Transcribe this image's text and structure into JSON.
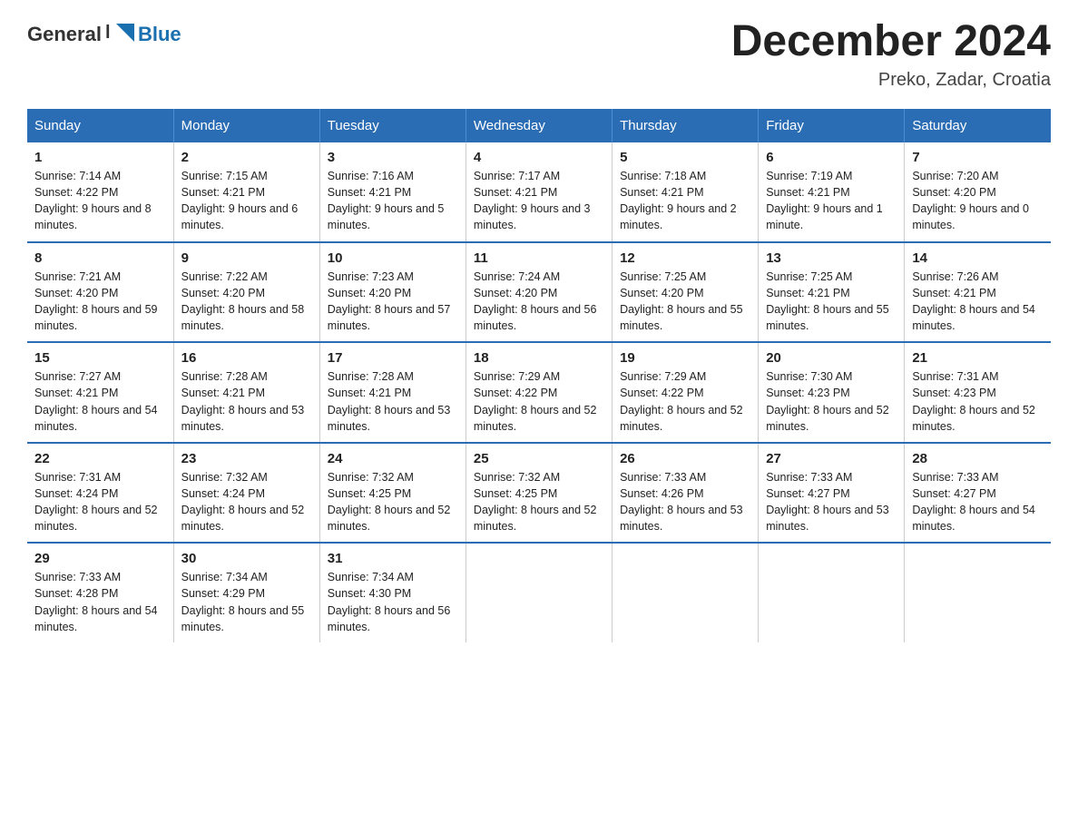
{
  "header": {
    "logo_text_general": "General",
    "logo_text_blue": "Blue",
    "month_title": "December 2024",
    "location": "Preko, Zadar, Croatia"
  },
  "days_of_week": [
    "Sunday",
    "Monday",
    "Tuesday",
    "Wednesday",
    "Thursday",
    "Friday",
    "Saturday"
  ],
  "weeks": [
    [
      {
        "day": "1",
        "sunrise": "7:14 AM",
        "sunset": "4:22 PM",
        "daylight": "9 hours and 8 minutes."
      },
      {
        "day": "2",
        "sunrise": "7:15 AM",
        "sunset": "4:21 PM",
        "daylight": "9 hours and 6 minutes."
      },
      {
        "day": "3",
        "sunrise": "7:16 AM",
        "sunset": "4:21 PM",
        "daylight": "9 hours and 5 minutes."
      },
      {
        "day": "4",
        "sunrise": "7:17 AM",
        "sunset": "4:21 PM",
        "daylight": "9 hours and 3 minutes."
      },
      {
        "day": "5",
        "sunrise": "7:18 AM",
        "sunset": "4:21 PM",
        "daylight": "9 hours and 2 minutes."
      },
      {
        "day": "6",
        "sunrise": "7:19 AM",
        "sunset": "4:21 PM",
        "daylight": "9 hours and 1 minute."
      },
      {
        "day": "7",
        "sunrise": "7:20 AM",
        "sunset": "4:20 PM",
        "daylight": "9 hours and 0 minutes."
      }
    ],
    [
      {
        "day": "8",
        "sunrise": "7:21 AM",
        "sunset": "4:20 PM",
        "daylight": "8 hours and 59 minutes."
      },
      {
        "day": "9",
        "sunrise": "7:22 AM",
        "sunset": "4:20 PM",
        "daylight": "8 hours and 58 minutes."
      },
      {
        "day": "10",
        "sunrise": "7:23 AM",
        "sunset": "4:20 PM",
        "daylight": "8 hours and 57 minutes."
      },
      {
        "day": "11",
        "sunrise": "7:24 AM",
        "sunset": "4:20 PM",
        "daylight": "8 hours and 56 minutes."
      },
      {
        "day": "12",
        "sunrise": "7:25 AM",
        "sunset": "4:20 PM",
        "daylight": "8 hours and 55 minutes."
      },
      {
        "day": "13",
        "sunrise": "7:25 AM",
        "sunset": "4:21 PM",
        "daylight": "8 hours and 55 minutes."
      },
      {
        "day": "14",
        "sunrise": "7:26 AM",
        "sunset": "4:21 PM",
        "daylight": "8 hours and 54 minutes."
      }
    ],
    [
      {
        "day": "15",
        "sunrise": "7:27 AM",
        "sunset": "4:21 PM",
        "daylight": "8 hours and 54 minutes."
      },
      {
        "day": "16",
        "sunrise": "7:28 AM",
        "sunset": "4:21 PM",
        "daylight": "8 hours and 53 minutes."
      },
      {
        "day": "17",
        "sunrise": "7:28 AM",
        "sunset": "4:21 PM",
        "daylight": "8 hours and 53 minutes."
      },
      {
        "day": "18",
        "sunrise": "7:29 AM",
        "sunset": "4:22 PM",
        "daylight": "8 hours and 52 minutes."
      },
      {
        "day": "19",
        "sunrise": "7:29 AM",
        "sunset": "4:22 PM",
        "daylight": "8 hours and 52 minutes."
      },
      {
        "day": "20",
        "sunrise": "7:30 AM",
        "sunset": "4:23 PM",
        "daylight": "8 hours and 52 minutes."
      },
      {
        "day": "21",
        "sunrise": "7:31 AM",
        "sunset": "4:23 PM",
        "daylight": "8 hours and 52 minutes."
      }
    ],
    [
      {
        "day": "22",
        "sunrise": "7:31 AM",
        "sunset": "4:24 PM",
        "daylight": "8 hours and 52 minutes."
      },
      {
        "day": "23",
        "sunrise": "7:32 AM",
        "sunset": "4:24 PM",
        "daylight": "8 hours and 52 minutes."
      },
      {
        "day": "24",
        "sunrise": "7:32 AM",
        "sunset": "4:25 PM",
        "daylight": "8 hours and 52 minutes."
      },
      {
        "day": "25",
        "sunrise": "7:32 AM",
        "sunset": "4:25 PM",
        "daylight": "8 hours and 52 minutes."
      },
      {
        "day": "26",
        "sunrise": "7:33 AM",
        "sunset": "4:26 PM",
        "daylight": "8 hours and 53 minutes."
      },
      {
        "day": "27",
        "sunrise": "7:33 AM",
        "sunset": "4:27 PM",
        "daylight": "8 hours and 53 minutes."
      },
      {
        "day": "28",
        "sunrise": "7:33 AM",
        "sunset": "4:27 PM",
        "daylight": "8 hours and 54 minutes."
      }
    ],
    [
      {
        "day": "29",
        "sunrise": "7:33 AM",
        "sunset": "4:28 PM",
        "daylight": "8 hours and 54 minutes."
      },
      {
        "day": "30",
        "sunrise": "7:34 AM",
        "sunset": "4:29 PM",
        "daylight": "8 hours and 55 minutes."
      },
      {
        "day": "31",
        "sunrise": "7:34 AM",
        "sunset": "4:30 PM",
        "daylight": "8 hours and 56 minutes."
      },
      null,
      null,
      null,
      null
    ]
  ]
}
